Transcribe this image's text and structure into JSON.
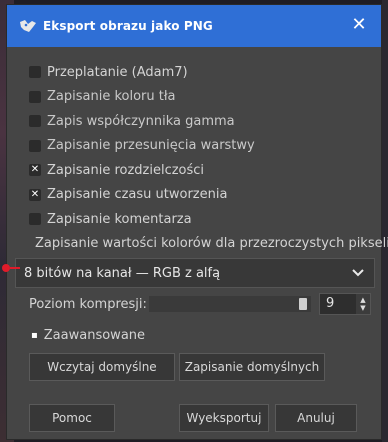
{
  "window": {
    "title": "Eksport obrazu jako PNG",
    "close_glyph": "✕"
  },
  "options": [
    {
      "label": "Przeplatanie (Adam7)",
      "checked": false
    },
    {
      "label": "Zapisanie koloru tła",
      "checked": false
    },
    {
      "label": "Zapis współczynnika gamma",
      "checked": false
    },
    {
      "label": "Zapisanie przesunięcia warstwy",
      "checked": false
    },
    {
      "label": "Zapisanie rozdzielczości",
      "checked": true
    },
    {
      "label": "Zapisanie czasu utworzenia",
      "checked": true
    },
    {
      "label": "Zapisanie komentarza",
      "checked": false
    },
    {
      "label": "Zapisanie wartości kolorów dla przezroczystych pikseli",
      "checked": false
    }
  ],
  "format_combo": {
    "value": "8 bitów na kanał — RGB z alfą",
    "icon": "chevron-down-icon"
  },
  "compression": {
    "label": "Poziom kompresji:",
    "value": "9",
    "level_fraction": 1.0
  },
  "advanced": {
    "label": "Zaawansowane"
  },
  "buttons": {
    "load_defaults": "Wczytaj domyślne",
    "save_defaults": "Zapisanie domyślnych",
    "help": "Pomoc",
    "export": "Wyeksportuj",
    "cancel": "Anuluj"
  },
  "colors": {
    "titlebar": "#2f6fd6",
    "dialog_bg": "#454545",
    "marker": "#e01b2a"
  }
}
